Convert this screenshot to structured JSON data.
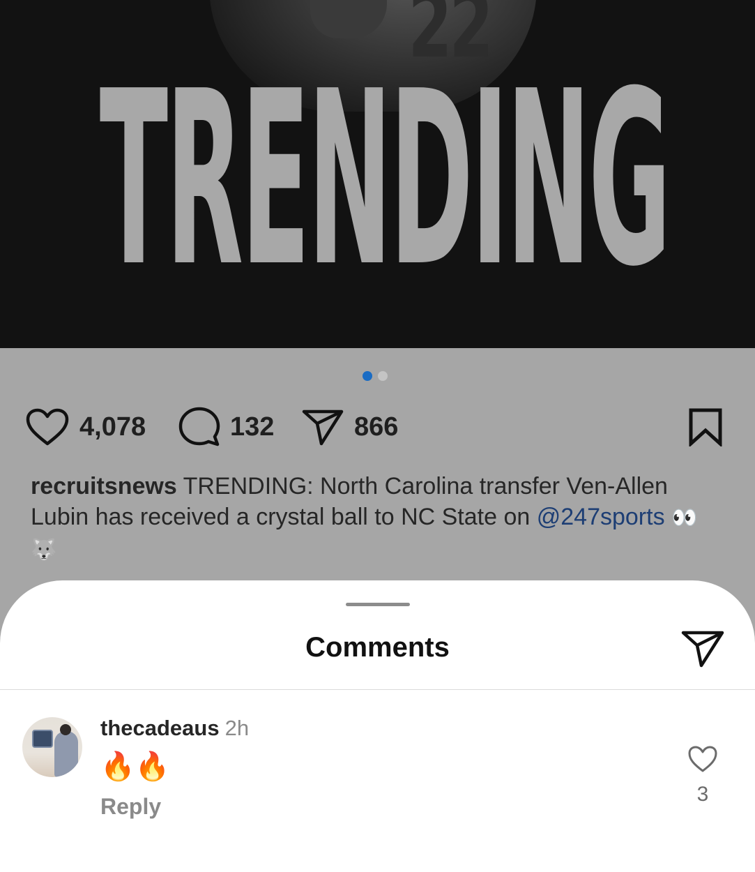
{
  "post": {
    "image_text": "TRENDING",
    "jersey_number": "22",
    "carousel": {
      "count": 2,
      "active_index": 0
    },
    "actions": {
      "likes": "4,078",
      "comments": "132",
      "shares": "866"
    },
    "caption": {
      "username": "recruitsnews",
      "text": "TRENDING: North Carolina transfer Ven-Allen Lubin has received a crystal ball to NC State on",
      "mention": "@247sports",
      "emojis": "👀🐺"
    }
  },
  "comments_sheet": {
    "title": "Comments",
    "comments": [
      {
        "username": "thecadeaus",
        "time": "2h",
        "text": "🔥🔥",
        "reply_label": "Reply",
        "like_count": "3"
      }
    ]
  },
  "icons": {
    "like": "heart-icon",
    "comment": "comment-bubble-icon",
    "share": "paper-plane-icon",
    "save": "bookmark-icon"
  },
  "colors": {
    "active_dot": "#1a6cc4",
    "mention": "#1d3e74",
    "overlay_background": "#a6a6a6"
  }
}
